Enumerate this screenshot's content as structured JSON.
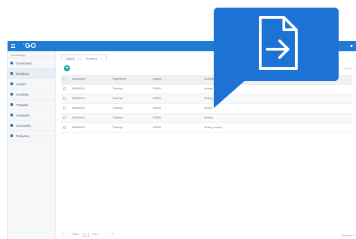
{
  "app": {
    "logo_prefix": "'",
    "logo_text": "GO",
    "accent": "#1f7bd6",
    "callout_color": "#1c73d3"
  },
  "sidebar": {
    "header": "Συναλλαγές",
    "items": [
      {
        "label": "Συναλλαγές",
        "icon": "list-icon"
      },
      {
        "label": "Πωλήσεις",
        "icon": "sales-icon",
        "active": true
      },
      {
        "label": "Αγορές",
        "icon": "purchases-icon"
      },
      {
        "label": "Αποθήκη",
        "icon": "warehouse-icon"
      },
      {
        "label": "Ψηφιακά",
        "icon": "digital-icon"
      },
      {
        "label": "Αναφορές",
        "icon": "reports-icon"
      },
      {
        "label": "Αποστολές",
        "icon": "shipping-icon"
      },
      {
        "label": "Ρυθμίσεις",
        "icon": "settings-icon"
      }
    ]
  },
  "tabs": [
    {
      "label": "Αρχική"
    },
    {
      "label": "Πωλήσεις",
      "active": true,
      "close": "×"
    }
  ],
  "toolbar": {
    "add_label": "+"
  },
  "table": {
    "headers": [
      "",
      "Ημερομηνία",
      "Παραστατικό",
      "Αριθμός",
      "Συναλλασσόμενος"
    ],
    "rows": [
      [
        "",
        "08/05/2019",
        "Τιμολόγιο",
        "000000",
        "Πελάτης"
      ],
      [
        "",
        "08/05/2019",
        "Τιμολόγιο",
        "000000",
        "Πελάτης λιανικής"
      ],
      [
        "",
        "08/05/2019",
        "Τιμολόγιο",
        "000000",
        "Πελάτης"
      ],
      [
        "",
        "08/05/2019",
        "Τιμολόγιο",
        "000000",
        "Πελάτης"
      ],
      [
        "",
        "08/05/2019",
        "Τιμολόγιο",
        "000000",
        "Πελάτης λιανικής"
      ]
    ]
  },
  "pager": {
    "items": [
      "«",
      "‹",
      "Σελίδα",
      "1",
      "από 1",
      "›",
      "»",
      "⟳"
    ],
    "summary": "Εγγραφές: 5"
  },
  "side_label": "Σύνολο",
  "icons": {
    "callout": "export-file-icon",
    "menu": "hamburger-menu-icon"
  }
}
